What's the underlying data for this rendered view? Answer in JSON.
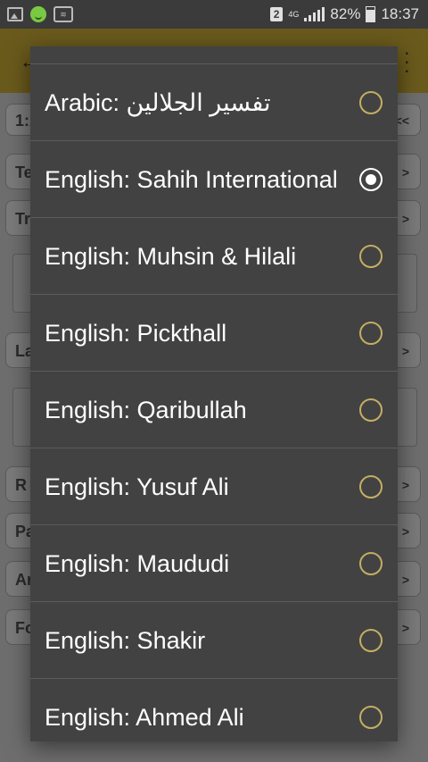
{
  "status_bar": {
    "notification_count": "2",
    "network": "4G",
    "battery": "82%",
    "time": "18:37",
    "icons": [
      "image-icon",
      "smiley-icon",
      "wifi-hotspot-icon",
      "signal-icon",
      "battery-icon"
    ]
  },
  "background": {
    "verse_prefix": "1:A",
    "nav_next": "<<",
    "items": [
      {
        "label": "Te"
      },
      {
        "label": "Tr"
      },
      {
        "label": "La"
      },
      {
        "label": "R"
      },
      {
        "label": "Pa"
      },
      {
        "label": "Ar"
      },
      {
        "label": "Fo"
      }
    ]
  },
  "dialog": {
    "options": [
      {
        "label": "Arabic: تفسير الجلالين",
        "selected": false
      },
      {
        "label": "English: Sahih International",
        "selected": true
      },
      {
        "label": "English: Muhsin & Hilali",
        "selected": false
      },
      {
        "label": "English: Pickthall",
        "selected": false
      },
      {
        "label": "English: Qaribullah",
        "selected": false
      },
      {
        "label": "English: Yusuf Ali",
        "selected": false
      },
      {
        "label": "English: Maududi",
        "selected": false
      },
      {
        "label": "English: Shakir",
        "selected": false
      },
      {
        "label": "English: Ahmed Ali",
        "selected": false
      }
    ]
  },
  "colors": {
    "dialog_bg": "#424242",
    "radio_unchecked": "#c4ae63",
    "radio_checked": "#ffffff",
    "appbar": "#6a5a1c"
  }
}
